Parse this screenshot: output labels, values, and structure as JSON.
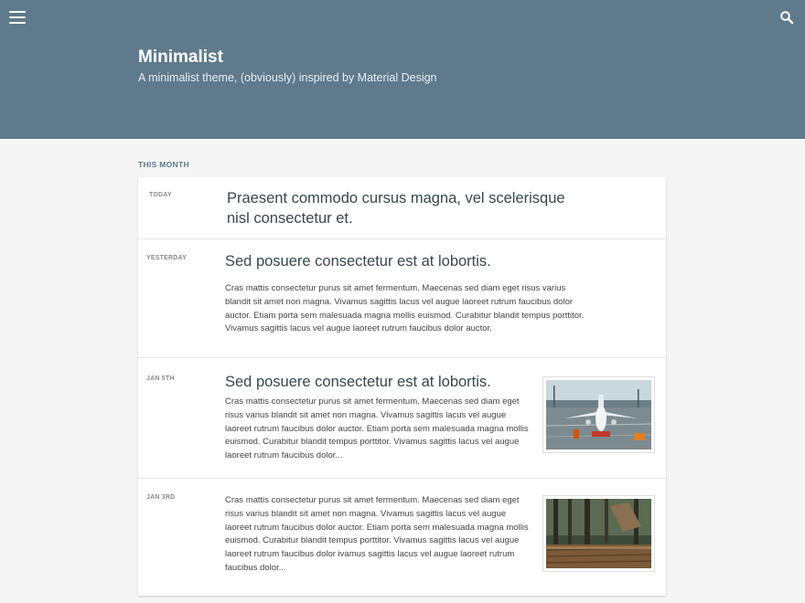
{
  "header": {
    "site_title": "Minimalist",
    "site_subtitle": "A minimalist theme, (obviously) inspired by Material Design"
  },
  "section": {
    "label": "THIS MONTH"
  },
  "entries": [
    {
      "date": "TODAY",
      "title": "Praesent commodo cursus magna, vel scelerisque nisl consectetur et.",
      "excerpt": ""
    },
    {
      "date": "YESTERDAY",
      "title": "Sed posuere consectetur est at lobortis.",
      "excerpt": "Cras mattis consectetur purus sit amet fermentum. Maecenas sed diam eget risus varius blandit sit amet non magna. Vivamus sagittis lacus vel augue laoreet rutrum faucibus dolor auctor. Etiam porta sem malesuada magna mollis euismod. Curabitur blandit tempus porttitor. Vivamus sagittis lacus vel augue laoreet rutrum faucibus dolor auctor."
    },
    {
      "date": "JAN 5th",
      "title": "Sed posuere consectetur est at lobortis.",
      "excerpt": "Cras mattis consectetur purus sit amet fermentum. Maecenas sed diam eget risus varius blandit sit amet non magna. Vivamus sagittis lacus vel augue laoreet rutrum faucibus dolor auctor. Etiam porta sem malesuada magna mollis euismod. Curabitur blandit tempus porttitor. Vivamus sagittis lacus vel augue laoreet rutrum faucibus dolor...",
      "image": "airplane-photo"
    },
    {
      "date": "JAN 3rd",
      "title": "",
      "excerpt": "Cras mattis consectetur purus sit amet fermentum. Maecenas sed diam eget risus varius blandit sit amet non magna. Vivamus sagittis lacus vel augue laoreet rutrum faucibus dolor auctor. Etiam porta sem malesuada magna mollis euismod. Curabitur blandit tempus porttitor. Vivamus sagittis lacus vel augue laoreet rutrum faucibus dolor ivamus sagittis lacus vel augue laoreet rutrum faucibus dolor...",
      "image": "forest-photo"
    }
  ],
  "icons": {
    "menu": "menu-icon",
    "search": "search-icon"
  },
  "colors": {
    "header_bg": "#5f7a8c",
    "accent": "#5f7a8c"
  }
}
